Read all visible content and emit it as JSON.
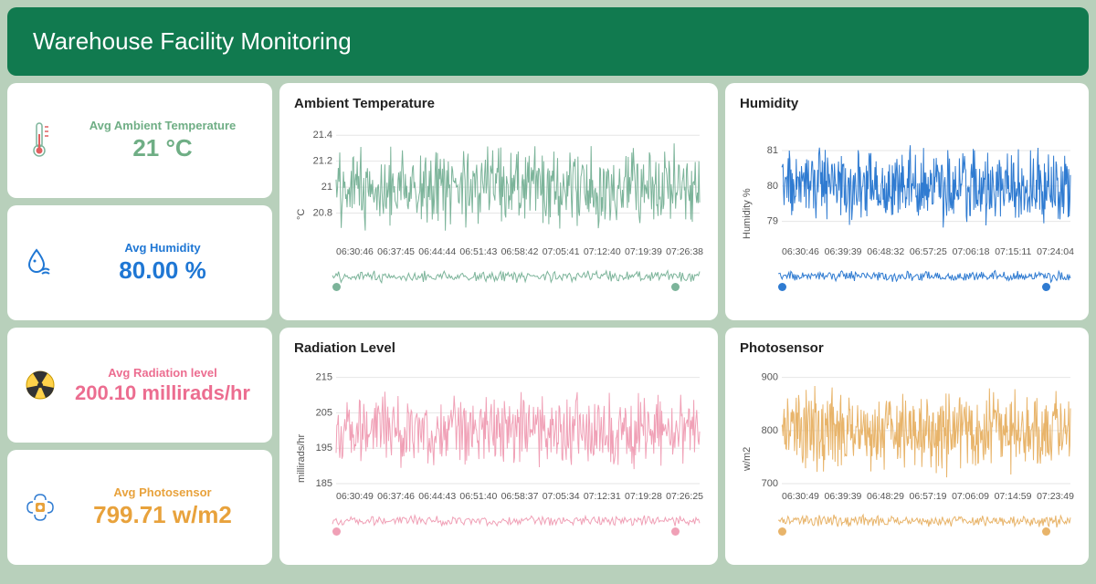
{
  "header": {
    "title": "Warehouse Facility Monitoring"
  },
  "kpis": {
    "temp": {
      "label": "Avg Ambient Temperature",
      "value": "21 °C"
    },
    "humidity": {
      "label": "Avg Humidity",
      "value": "80.00 %"
    },
    "radiation": {
      "label": "Avg Radiation level",
      "value": "200.10 millirads/hr"
    },
    "photo": {
      "label": "Avg Photosensor",
      "value": "799.71 w/m2"
    }
  },
  "panels": {
    "temp": {
      "title": "Ambient Temperature",
      "ylabel": "°C"
    },
    "humidity": {
      "title": "Humidity",
      "ylabel": "Humidity %"
    },
    "radiation": {
      "title": "Radiation Level",
      "ylabel": "millirads/hr"
    },
    "photo": {
      "title": "Photosensor",
      "ylabel": "w/m2"
    }
  },
  "colors": {
    "green": "#7cb49a",
    "blue": "#2f7bd1",
    "pink": "#f0a0b6",
    "orange": "#e8b46a"
  },
  "chart_data": [
    {
      "type": "line",
      "id": "temp",
      "title": "Ambient Temperature",
      "ylabel": "°C",
      "ylim": [
        20.6,
        21.5
      ],
      "yticks": [
        20.8,
        21,
        21.2,
        21.4
      ],
      "x_labels": [
        "06:30:46",
        "06:37:45",
        "06:44:44",
        "06:51:43",
        "06:58:42",
        "07:05:41",
        "07:12:40",
        "07:19:39",
        "07:26:38"
      ],
      "mean": 21.0,
      "noise_amp": 0.35
    },
    {
      "type": "line",
      "id": "humidity",
      "title": "Humidity",
      "ylabel": "Humidity %",
      "ylim": [
        78.5,
        81.8
      ],
      "yticks": [
        79,
        80,
        81
      ],
      "x_labels": [
        "06:30:46",
        "06:39:39",
        "06:48:32",
        "06:57:25",
        "07:06:18",
        "07:15:11",
        "07:24:04"
      ],
      "mean": 80.0,
      "noise_amp": 1.2
    },
    {
      "type": "line",
      "id": "radiation",
      "title": "Radiation Level",
      "ylabel": "millirads/hr",
      "ylim": [
        185,
        218
      ],
      "yticks": [
        185,
        195,
        205,
        215
      ],
      "x_labels": [
        "06:30:49",
        "06:37:46",
        "06:44:43",
        "06:51:40",
        "06:58:37",
        "07:05:34",
        "07:12:31",
        "07:19:28",
        "07:26:25"
      ],
      "mean": 200.1,
      "noise_amp": 12
    },
    {
      "type": "line",
      "id": "photo",
      "title": "Photosensor",
      "ylabel": "w/m2",
      "ylim": [
        700,
        920
      ],
      "yticks": [
        700,
        800,
        900
      ],
      "x_labels": [
        "06:30:49",
        "06:39:39",
        "06:48:29",
        "06:57:19",
        "07:06:09",
        "07:14:59",
        "07:23:49"
      ],
      "mean": 799.71,
      "noise_amp": 90
    }
  ]
}
